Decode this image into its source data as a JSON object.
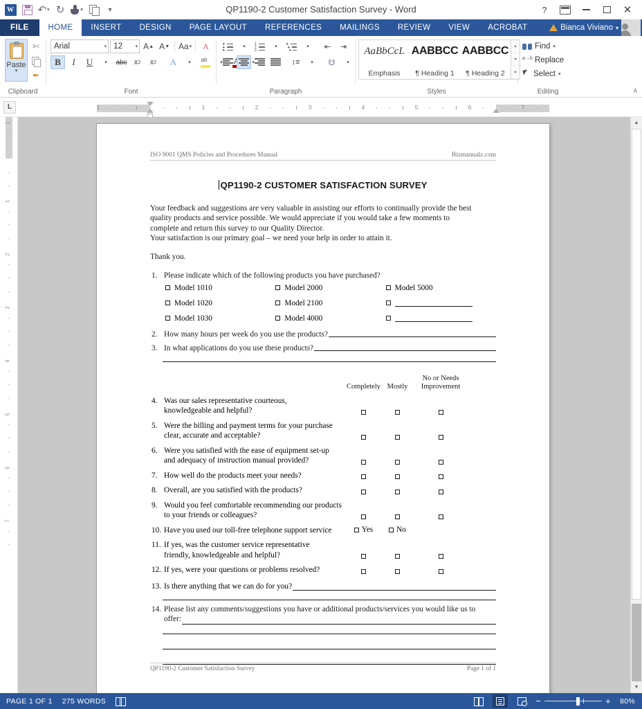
{
  "window": {
    "title": "QP1190-2 Customer Satisfaction Survey - Word",
    "help_glyph": "?",
    "ribbon_display_name": "ribbon-display-options",
    "minimize_glyph": "",
    "restore_glyph": "",
    "close_glyph": "✕"
  },
  "quick_access": {
    "word_logo": "W",
    "items": [
      {
        "name": "save-icon",
        "label": "Save"
      },
      {
        "name": "undo-icon",
        "label": "Undo",
        "glyph": "↶"
      },
      {
        "name": "redo-icon",
        "label": "Repeat",
        "glyph": "↻"
      },
      {
        "name": "touch-mode-icon",
        "label": "Touch/Mouse Mode"
      },
      {
        "name": "copy-icon",
        "label": "Copy"
      },
      {
        "name": "customize-icon",
        "label": "Customize Quick Access Toolbar",
        "glyph": "▾"
      }
    ]
  },
  "tabs": {
    "file": "FILE",
    "items": [
      "HOME",
      "INSERT",
      "DESIGN",
      "PAGE LAYOUT",
      "REFERENCES",
      "MAILINGS",
      "REVIEW",
      "VIEW",
      "ACROBAT"
    ],
    "active": "HOME"
  },
  "account": {
    "user_name": "Bianca Viviano",
    "caret": "▾"
  },
  "ribbon": {
    "clipboard": {
      "label": "Clipboard",
      "paste_label": "Paste",
      "paste_caret": "▾",
      "cut_label": "Cut",
      "copy_label": "Copy",
      "format_painter_label": "Format Painter",
      "dialog_launcher": "⤡"
    },
    "font": {
      "label": "Font",
      "font_name": "Arial",
      "font_size": "12",
      "caret": "▾",
      "grow_font": "A",
      "shrink_font": "A",
      "change_case": "Aa",
      "clear_formatting": "A",
      "bold": "B",
      "italic": "I",
      "underline": "U",
      "strikethrough": "abc",
      "subscript": "x",
      "superscript": "x",
      "text_effects": "A",
      "highlight": "ab",
      "font_color": "A",
      "dialog_launcher": "⤡"
    },
    "paragraph": {
      "label": "Paragraph",
      "bullets": "Bullets",
      "numbering": "Numbering",
      "multilevel": "Multilevel List",
      "decrease_indent": "Decrease Indent",
      "increase_indent": "Increase Indent",
      "sort": "Sort",
      "show_marks": "¶",
      "align_left": "Align Left",
      "align_center": "Center",
      "align_right": "Align Right",
      "justify": "Justify",
      "line_spacing": "Line and Paragraph Spacing",
      "shading": "Shading",
      "borders": "Borders",
      "dialog_launcher": "⤡"
    },
    "styles": {
      "label": "Styles",
      "items": [
        {
          "preview": "AaBbCcL",
          "name": "Emphasis"
        },
        {
          "preview": "AABBCC",
          "name": "¶ Heading 1"
        },
        {
          "preview": "AABBCC",
          "name": "¶ Heading 2"
        }
      ],
      "scroll_up": "▴",
      "scroll_down": "▾",
      "more": "▾",
      "dialog_launcher": "⤡"
    },
    "editing": {
      "label": "Editing",
      "find": "Find",
      "find_caret": "▾",
      "replace": "Replace",
      "select": "Select",
      "select_caret": "▾"
    },
    "collapse": "∧"
  },
  "ruler": {
    "tab_stop_marker": "L",
    "h_numbers": [
      "1",
      "1",
      "2",
      "3",
      "4",
      "5",
      "6",
      "7"
    ],
    "v_numbers": [
      "1",
      "1",
      "2",
      "3",
      "4",
      "5",
      "6",
      "7"
    ]
  },
  "document": {
    "header_left": "ISO 9001 QMS Policies and Procedures Manual",
    "header_right": "Bizmanualz.com",
    "title": "QP1190-2 CUSTOMER SATISFACTION SURVEY",
    "intro_lines": [
      "Your feedback and suggestions are very valuable in assisting our efforts to continually provide the best",
      "quality products and service possible.  We would appreciate if you would take a few moments to",
      "complete and return this survey to our Quality Director.",
      "Your satisfaction is our primary goal – we need your help in order to attain it."
    ],
    "thank_you": "Thank you.",
    "q1": {
      "num": "1.",
      "text": "Please indicate which of the following products you have purchased?",
      "rows": [
        [
          "Model 1010",
          "Model 2000",
          "Model 5000"
        ],
        [
          "Model 1020",
          "Model 2100",
          ""
        ],
        [
          "Model 1030",
          "Model 4000",
          ""
        ]
      ]
    },
    "q2": {
      "num": "2.",
      "text": "How many hours per week do you use the products?"
    },
    "q3": {
      "num": "3.",
      "text": "In what applications do you use these products?"
    },
    "rating_headers": [
      "Completely",
      "Mostly",
      "No or Needs Improvement"
    ],
    "rating_header_3_line1": "No or Needs",
    "rating_header_3_line2": "Improvement",
    "rating_questions": [
      {
        "num": "4.",
        "lines": [
          "Was our sales representative courteous,",
          "knowledgeable and helpful?"
        ]
      },
      {
        "num": "5.",
        "lines": [
          "Were the billing and payment terms for your purchase",
          "clear, accurate and acceptable?"
        ]
      },
      {
        "num": "6.",
        "lines": [
          "Were you satisfied with the ease of equipment set-up",
          "and adequacy of instruction manual provided?"
        ]
      },
      {
        "num": "7.",
        "lines": [
          "How well do the products meet your needs?"
        ]
      },
      {
        "num": "8.",
        "lines": [
          "Overall, are you satisfied with the products?"
        ]
      },
      {
        "num": "9.",
        "lines": [
          "Would you feel comfortable recommending our products",
          "to your friends or colleagues?"
        ]
      }
    ],
    "q10": {
      "num": "10.",
      "text": "Have you used our toll-free telephone support service",
      "yes": "Yes",
      "no": "No"
    },
    "q11": {
      "num": "11.",
      "lines": [
        "If yes, was the customer service representative",
        "friendly, knowledgeable and helpful?"
      ]
    },
    "q12": {
      "num": "12.",
      "lines": [
        "If yes, were your questions or problems resolved?"
      ]
    },
    "q13": {
      "num": "13.",
      "text": "Is there anything that we can do for you?"
    },
    "q14": {
      "num": "14.",
      "line1": "Please list any comments/suggestions you have or additional products/services you would like us to",
      "line2": "offer:"
    },
    "footer_left": "QP1190-2 Customer Satisfaction Survey",
    "footer_right": "Page 1 of 1"
  },
  "status_bar": {
    "page_info": "PAGE 1 OF 1",
    "word_count": "275 WORDS",
    "proofing_icon": "proofing-errors-icon",
    "views": [
      {
        "name": "read-mode-view",
        "active": false
      },
      {
        "name": "print-layout-view",
        "active": true
      },
      {
        "name": "web-layout-view",
        "active": false
      }
    ],
    "zoom_out": "−",
    "zoom_in": "+",
    "zoom_level": "80%"
  },
  "colors": {
    "accent": "#2b579a",
    "file_tab": "#1e3c6e",
    "workspace": "#c8c8c8",
    "ribbon_bg": "#ffffff"
  }
}
